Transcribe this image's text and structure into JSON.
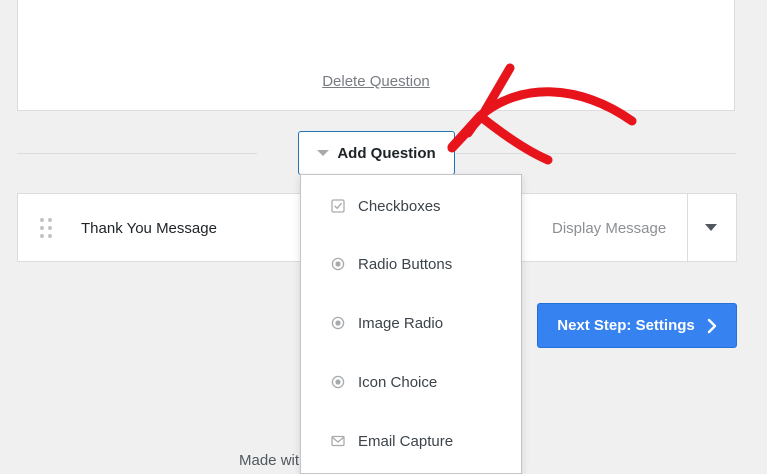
{
  "question_card": {
    "delete_label": "Delete Question"
  },
  "add_question": {
    "label": "Add Question"
  },
  "row": {
    "title": "Thank You Message",
    "type": "Display Message"
  },
  "next_step": {
    "label": "Next Step: Settings"
  },
  "footer": {
    "text": "Made wit"
  },
  "dropdown": {
    "items": [
      {
        "label": "Checkboxes",
        "icon": "checkbox-icon"
      },
      {
        "label": "Radio Buttons",
        "icon": "radio-icon"
      },
      {
        "label": "Image Radio",
        "icon": "radio-icon"
      },
      {
        "label": "Icon Choice",
        "icon": "radio-icon"
      },
      {
        "label": "Email Capture",
        "icon": "envelope-icon"
      }
    ]
  },
  "colors": {
    "accent": "#2271b1",
    "primary_button": "#3582f0",
    "annotation_arrow": "#e8141c"
  }
}
